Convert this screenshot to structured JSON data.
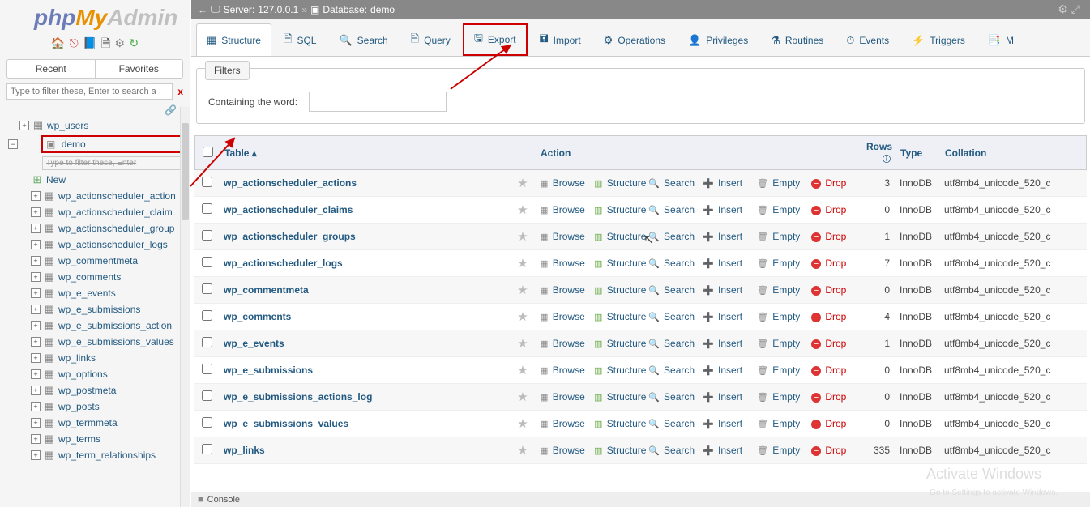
{
  "logo": {
    "p1": "php",
    "p2": "My",
    "p3": "Admin"
  },
  "left": {
    "tabs": [
      "Recent",
      "Favorites"
    ],
    "filter_placeholder": "Type to filter these, Enter to search a",
    "filter_x": "x",
    "tree_top": [
      {
        "label": "wp_users"
      }
    ],
    "demo_label": "demo",
    "demo_filter": "Type to filter these, Enter",
    "new_label": "New",
    "tables": [
      "wp_actionscheduler_action",
      "wp_actionscheduler_claim",
      "wp_actionscheduler_group",
      "wp_actionscheduler_logs",
      "wp_commentmeta",
      "wp_comments",
      "wp_e_events",
      "wp_e_submissions",
      "wp_e_submissions_action",
      "wp_e_submissions_values",
      "wp_links",
      "wp_options",
      "wp_postmeta",
      "wp_posts",
      "wp_termmeta",
      "wp_terms",
      "wp_term_relationships"
    ]
  },
  "server": {
    "server_label": "Server:",
    "server_val": "127.0.0.1",
    "sep": "»",
    "db_label": "Database:",
    "db_val": "demo"
  },
  "maintabs": [
    {
      "label": "Structure",
      "active": true
    },
    {
      "label": "SQL"
    },
    {
      "label": "Search"
    },
    {
      "label": "Query"
    },
    {
      "label": "Export",
      "hl": true
    },
    {
      "label": "Import"
    },
    {
      "label": "Operations"
    },
    {
      "label": "Privileges"
    },
    {
      "label": "Routines"
    },
    {
      "label": "Events"
    },
    {
      "label": "Triggers"
    },
    {
      "label": "M"
    }
  ],
  "filters": {
    "legend": "Filters",
    "label": "Containing the word:"
  },
  "cols": {
    "table": "Table",
    "action": "Action",
    "rows": "Rows",
    "help": "ⓘ",
    "type": "Type",
    "collation": "Collation"
  },
  "actions": {
    "browse": "Browse",
    "structure": "Structure",
    "search": "Search",
    "insert": "Insert",
    "empty": "Empty",
    "drop": "Drop"
  },
  "rows": [
    {
      "name": "wp_actionscheduler_actions",
      "rows": 3,
      "type": "InnoDB",
      "coll": "utf8mb4_unicode_520_c"
    },
    {
      "name": "wp_actionscheduler_claims",
      "rows": 0,
      "type": "InnoDB",
      "coll": "utf8mb4_unicode_520_c"
    },
    {
      "name": "wp_actionscheduler_groups",
      "rows": 1,
      "type": "InnoDB",
      "coll": "utf8mb4_unicode_520_c"
    },
    {
      "name": "wp_actionscheduler_logs",
      "rows": 7,
      "type": "InnoDB",
      "coll": "utf8mb4_unicode_520_c"
    },
    {
      "name": "wp_commentmeta",
      "rows": 0,
      "type": "InnoDB",
      "coll": "utf8mb4_unicode_520_c"
    },
    {
      "name": "wp_comments",
      "rows": 4,
      "type": "InnoDB",
      "coll": "utf8mb4_unicode_520_c"
    },
    {
      "name": "wp_e_events",
      "rows": 1,
      "type": "InnoDB",
      "coll": "utf8mb4_unicode_520_c"
    },
    {
      "name": "wp_e_submissions",
      "rows": 0,
      "type": "InnoDB",
      "coll": "utf8mb4_unicode_520_c"
    },
    {
      "name": "wp_e_submissions_actions_log",
      "rows": 0,
      "type": "InnoDB",
      "coll": "utf8mb4_unicode_520_c"
    },
    {
      "name": "wp_e_submissions_values",
      "rows": 0,
      "type": "InnoDB",
      "coll": "utf8mb4_unicode_520_c"
    },
    {
      "name": "wp_links",
      "rows": 335,
      "type": "InnoDB",
      "coll": "utf8mb4_unicode_520_c"
    }
  ],
  "console": "Console",
  "watermark1": "Activate Windows",
  "watermark2": "Go to Settings to activate Windows."
}
